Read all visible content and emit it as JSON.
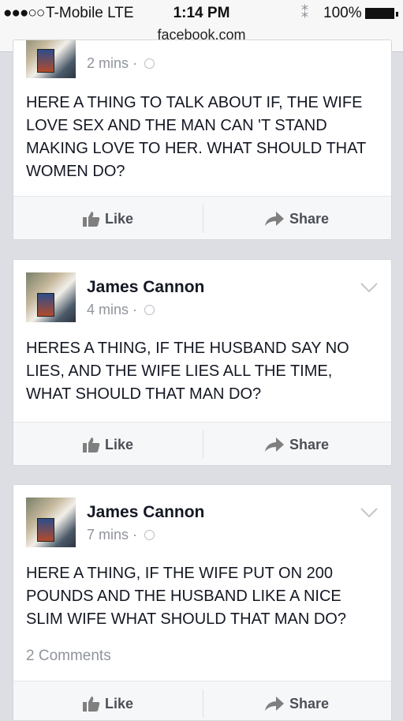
{
  "status_bar": {
    "signal": "●●●○○",
    "carrier": "T-Mobile",
    "network": "LTE",
    "time": "1:14 PM",
    "activity_indicator": "⁑",
    "battery": "100%",
    "battery_level": 1.0
  },
  "address_bar": {
    "url": "facebook.com"
  },
  "actions": {
    "like": "Like",
    "share": "Share"
  },
  "posts": [
    {
      "author": "",
      "time": "2 mins",
      "separator": "·",
      "text": "HERE A THING TO TALK ABOUT IF, THE WIFE LOVE SEX AND THE MAN CAN 'T STAND MAKING LOVE TO HER. WHAT SHOULD THAT WOMEN DO?"
    },
    {
      "author": "James Cannon",
      "time": "4 mins",
      "separator": "·",
      "text": "HERES A THING, IF THE HUSBAND SAY NO LIES, AND THE WIFE LIES ALL THE TIME, WHAT SHOULD THAT MAN DO?"
    },
    {
      "author": "James Cannon",
      "time": "7 mins",
      "separator": "·",
      "text": "HERE A THING, IF THE WIFE PUT ON 200 POUNDS AND THE HUSBAND LIKE A NICE SLIM WIFE WHAT SHOULD THAT MAN DO?",
      "comments": "2 Comments"
    }
  ]
}
